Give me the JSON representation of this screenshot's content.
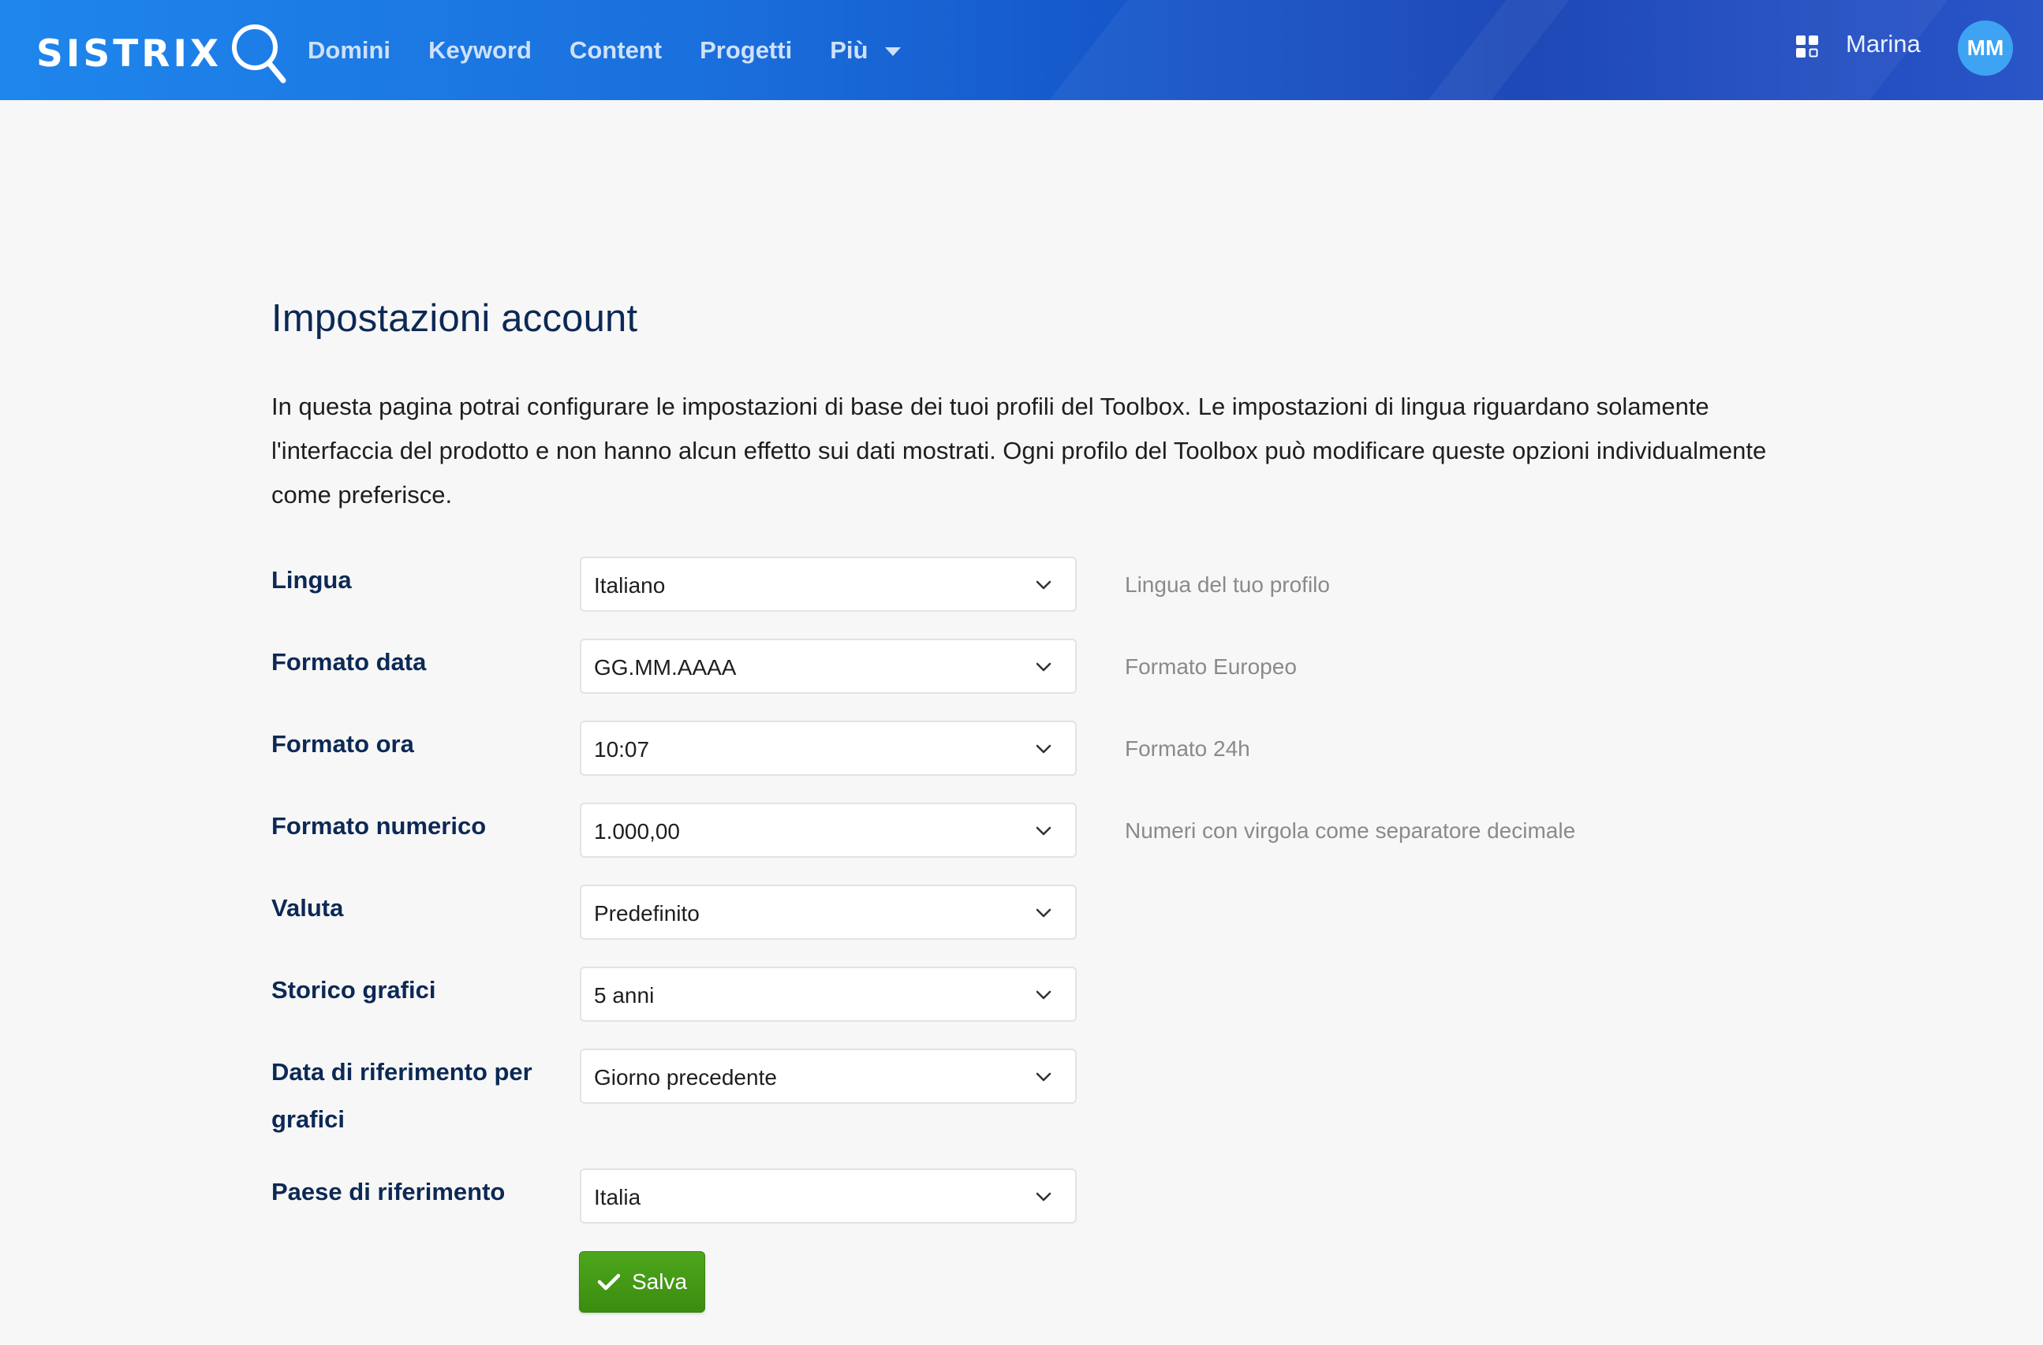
{
  "header": {
    "logo_text": "SISTRIX",
    "nav": [
      {
        "label": "Domini"
      },
      {
        "label": "Keyword"
      },
      {
        "label": "Content"
      },
      {
        "label": "Progetti"
      },
      {
        "label": "Più"
      }
    ],
    "apps_icon": "apps-grid-icon",
    "user_name": "Marina",
    "avatar_initials": "MM"
  },
  "page": {
    "title": "Impostazioni account",
    "intro": "In questa pagina potrai configurare le impostazioni di base dei tuoi profili del Toolbox. Le impostazioni di lingua riguardano solamente l'interfaccia del prodotto e non hanno alcun effetto sui dati mostrati. Ogni profilo del Toolbox può modificare queste opzioni individualmente come preferisce."
  },
  "settings": [
    {
      "label": "Lingua",
      "value": "Italiano",
      "hint": "Lingua del tuo profilo"
    },
    {
      "label": "Formato data",
      "value": "GG.MM.AAAA",
      "hint": "Formato Europeo"
    },
    {
      "label": "Formato ora",
      "value": "10:07",
      "hint": "Formato 24h"
    },
    {
      "label": "Formato numerico",
      "value": "1.000,00",
      "hint": "Numeri con virgola come separatore decimale"
    },
    {
      "label": "Valuta",
      "value": "Predefinito",
      "hint": ""
    },
    {
      "label": "Storico grafici",
      "value": "5 anni",
      "hint": ""
    },
    {
      "label": "Data di riferimento per grafici",
      "value": "Giorno precedente",
      "hint": ""
    },
    {
      "label": "Paese di riferimento",
      "value": "Italia",
      "hint": ""
    }
  ],
  "save_button": {
    "label": "Salva",
    "icon": "check-icon"
  },
  "colors": {
    "header_start": "#1e86ec",
    "header_end": "#1240b4",
    "title": "#0c2955",
    "save_green": "#43991a",
    "avatar": "#3ea3f2"
  }
}
